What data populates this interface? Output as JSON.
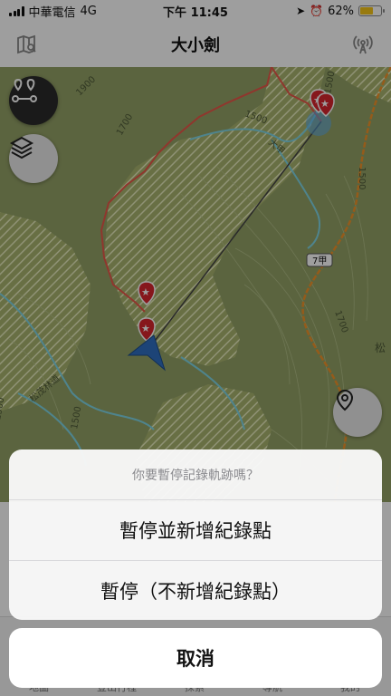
{
  "status": {
    "carrier": "中華電信",
    "network": "4G",
    "time": "下午 11:45",
    "battery": "62%",
    "battery_level": 0.62
  },
  "nav": {
    "title": "大小劍",
    "left_icon": "map-icon",
    "right_icon": "broadcast-icon"
  },
  "map": {
    "contour_labels": [
      "1900",
      "1700",
      "1500",
      "1500",
      "1500",
      "1700",
      "1500",
      "1500"
    ],
    "road_label": "7甲",
    "place_labels": [
      "松茂林道",
      "松",
      "大甲"
    ],
    "colors": {
      "track": "#e8574a",
      "river": "#7fd6e6",
      "road": "#f0932b",
      "terrain": "#9aa86a",
      "hatch": "#e7ecbd"
    }
  },
  "tabs": [
    {
      "label": "地圖"
    },
    {
      "label": "登山行程"
    },
    {
      "label": "探索"
    },
    {
      "label": "導航"
    },
    {
      "label": "我的"
    }
  ],
  "sheet": {
    "title": "你要暫停記錄軌跡嗎？",
    "actions": [
      {
        "label": "暫停並新增紀錄點"
      },
      {
        "label": "暫停（不新增紀錄點）"
      }
    ],
    "cancel": "取消"
  }
}
